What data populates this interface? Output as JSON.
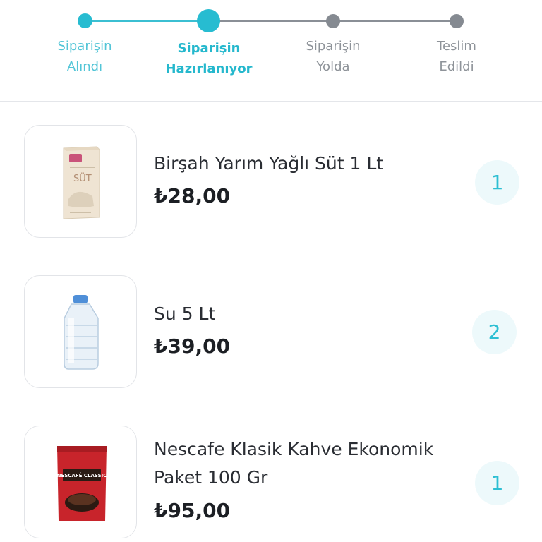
{
  "steps": [
    {
      "label": "Siparişin\nAlındı",
      "state": "done"
    },
    {
      "label": "Siparişin\nHazırlanıyor",
      "state": "current"
    },
    {
      "label": "Siparişin\nYolda",
      "state": "pending"
    },
    {
      "label": "Teslim\nEdildi",
      "state": "pending"
    }
  ],
  "items": [
    {
      "name": "Birşah Yarım Yağlı Süt 1 Lt",
      "price": "₺28,00",
      "quantity": "1",
      "image": "milk-carton",
      "image_text": "SÜT"
    },
    {
      "name": "Su 5 Lt",
      "price": "₺39,00",
      "quantity": "2",
      "image": "water-bottle"
    },
    {
      "name": "Nescafe Klasik Kahve Ekonomik Paket 100 Gr",
      "price": "₺95,00",
      "quantity": "1",
      "image": "coffee-pack",
      "image_text": "NESCAFÉ CLASSIC"
    }
  ],
  "colors": {
    "accent": "#27bcd1",
    "pending": "#858a91",
    "qty_bg": "#edf9fb",
    "price": "#1c1f24"
  }
}
